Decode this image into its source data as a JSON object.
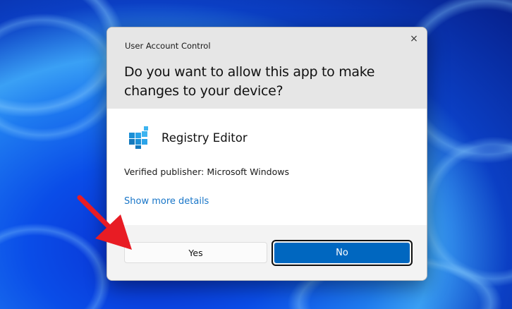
{
  "dialog": {
    "title": "User Account Control",
    "question": "Do you want to allow this app to make changes to your device?",
    "app_name": "Registry Editor",
    "publisher": "Verified publisher: Microsoft Windows",
    "more_details": "Show more details",
    "yes_label": "Yes",
    "no_label": "No",
    "close_icon": "×"
  },
  "colors": {
    "accent": "#0067c0",
    "link": "#1976c8",
    "annotation_arrow": "#e81c24"
  }
}
